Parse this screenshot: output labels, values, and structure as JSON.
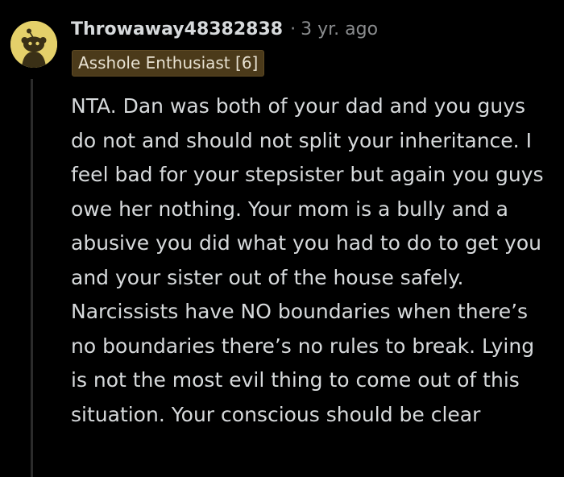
{
  "comment": {
    "username": "Throwaway48382838",
    "separator": "·",
    "timestamp": "3 yr. ago",
    "flair": "Asshole Enthusiast [6]",
    "avatar_icon": "snoo-avatar-icon",
    "avatar_color": "#e4d06a",
    "flair_color": "#4b3a1a",
    "body": "NTA. Dan was both of your dad and you guys do not and should not split your inheritance. I feel bad for your stepsister but again you guys owe her nothing. Your mom is a bully and a abusive you did what you had to do to get you and your sister out of the house safely. Narcissists have NO boundaries when there’s no boundaries there’s no rules to break. Lying is not the most evil thing to come out of this situation. Your conscious should be clear"
  }
}
